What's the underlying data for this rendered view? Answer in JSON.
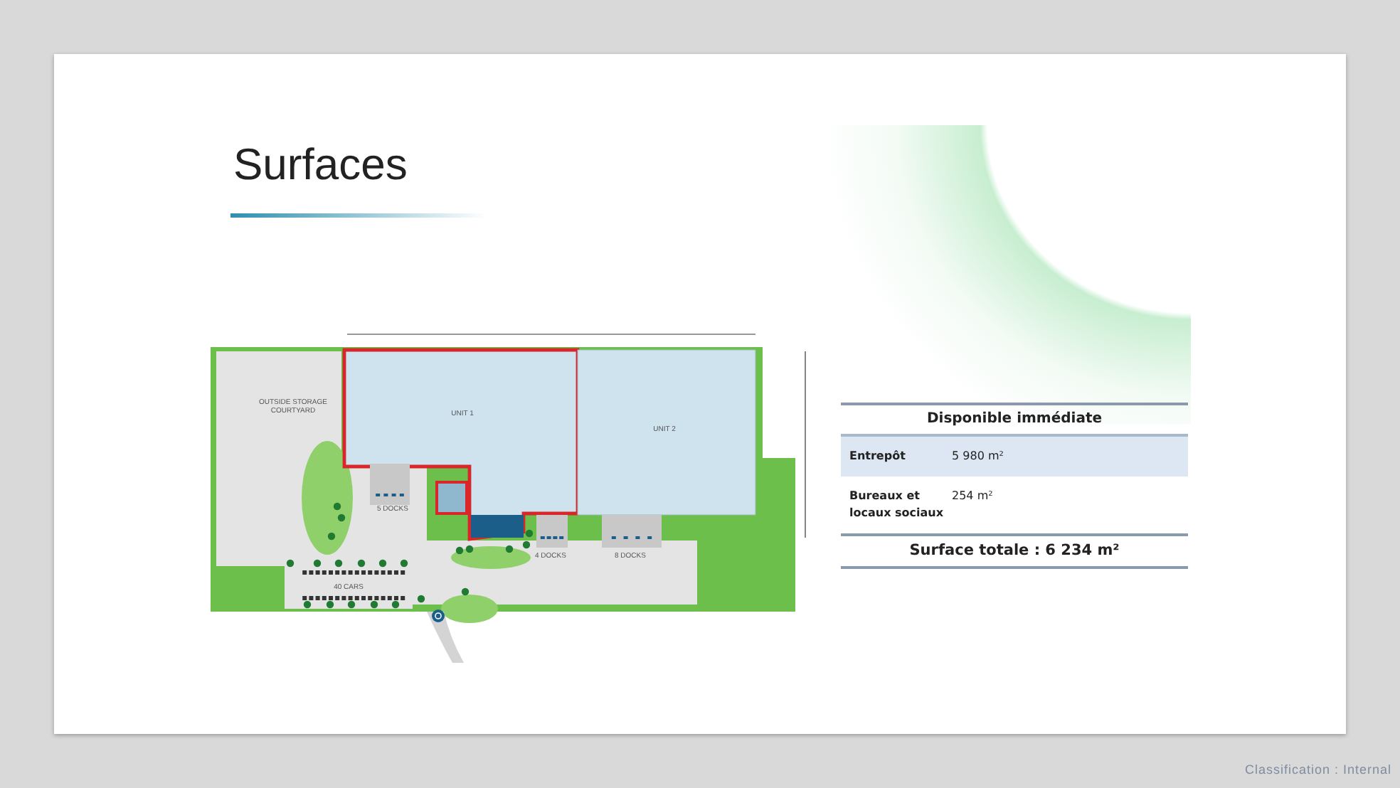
{
  "title": "Surfaces",
  "site_plan": {
    "courtyard_label": [
      "OUTSIDE STORAGE",
      "COURTYARD"
    ],
    "units": [
      {
        "label": "UNIT 1",
        "highlighted": true
      },
      {
        "label": "UNIT 2",
        "highlighted": false
      }
    ],
    "docks": [
      "5 DOCKS",
      "4 DOCKS",
      "8 DOCKS"
    ],
    "parking": "40 CARS"
  },
  "table": {
    "heading": "Disponible immédiate",
    "rows": [
      {
        "label": "Entrepôt",
        "value": "5 980 m²"
      },
      {
        "label": "Bureaux et locaux sociaux",
        "value": "254 m²"
      }
    ],
    "total": "Surface totale : 6 234 m²"
  },
  "classification": "Classification : Internal"
}
